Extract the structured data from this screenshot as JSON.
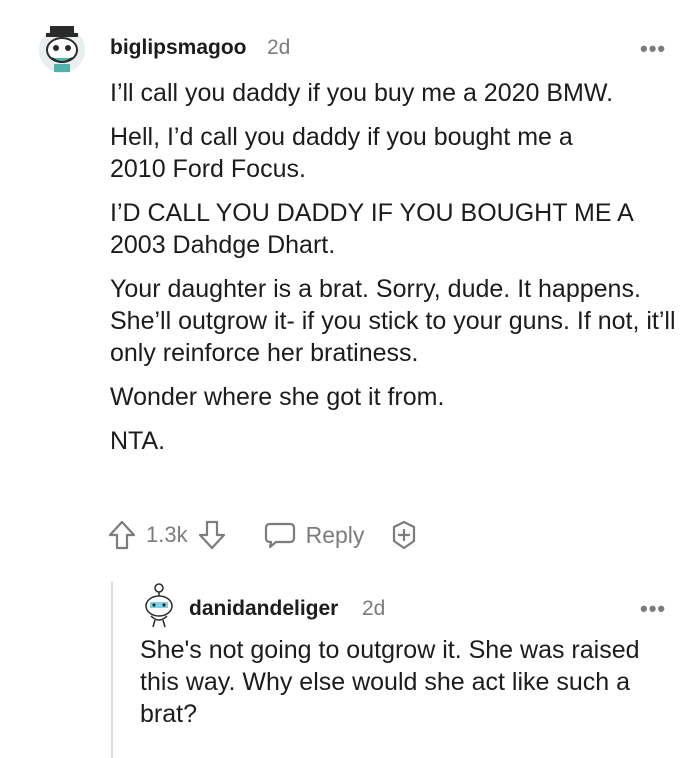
{
  "comment": {
    "username": "biglipsmagoo",
    "time": "2d",
    "paragraphs": [
      "I’ll call you daddy if you buy me a 2020 BMW.",
      "Hell, I’d call you daddy if you bought me a 2010 Ford Focus.",
      "I’D CALL YOU DADDY IF YOU BOUGHT ME A 2003 Dahdge Dhart.",
      "Your daughter is a brat. Sorry, dude. It happens. She’ll outgrow it- if you stick to your guns. If not, it’ll only reinforce her bratiness.",
      "Wonder where she got it from.",
      "NTA."
    ],
    "votes": "1.3k",
    "reply_label": "Reply"
  },
  "reply": {
    "username": "danidandeliger",
    "time": "2d",
    "text": "She's not going to outgrow it. She was raised this way. Why else would she act like such a brat?"
  },
  "icons": {
    "more": "more-options-icon",
    "upvote": "upvote-arrow-icon",
    "downvote": "downvote-arrow-icon",
    "reply": "speech-bubble-icon",
    "award": "award-plus-icon"
  },
  "colors": {
    "text": "#1c1c1c",
    "muted": "#7c7c7c",
    "thread_line": "#dcdcdc"
  }
}
